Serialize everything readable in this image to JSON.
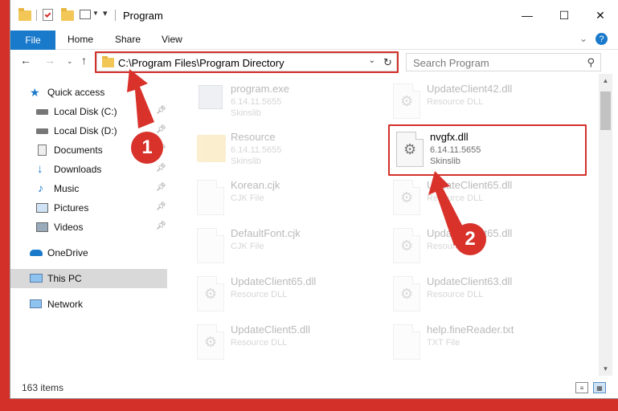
{
  "window": {
    "title": "Program"
  },
  "ribbon": {
    "file": "File",
    "home": "Home",
    "share": "Share",
    "view": "View"
  },
  "address": {
    "path": "C:\\Program Files\\Program Directory"
  },
  "search": {
    "placeholder": "Search Program"
  },
  "sidebar": {
    "items": [
      {
        "label": "Quick access",
        "icon": "star-icon"
      },
      {
        "label": "Local Disk (C:)",
        "icon": "drive-icon"
      },
      {
        "label": "Local Disk (D:)",
        "icon": "drive-icon"
      },
      {
        "label": "Documents",
        "icon": "documents-icon"
      },
      {
        "label": "Downloads",
        "icon": "download-arrow-icon"
      },
      {
        "label": "Music",
        "icon": "music-note-icon"
      },
      {
        "label": "Pictures",
        "icon": "pictures-icon"
      },
      {
        "label": "Videos",
        "icon": "video-icon"
      },
      {
        "label": "OneDrive",
        "icon": "cloud-icon"
      },
      {
        "label": "This PC",
        "icon": "computer-icon"
      },
      {
        "label": "Network",
        "icon": "network-icon"
      }
    ]
  },
  "files": [
    {
      "name": "program.exe",
      "line1": "6.14.11.5655",
      "line2": "Skinslib"
    },
    {
      "name": "UpdateClient42.dll",
      "line1": "Resource DLL",
      "line2": ""
    },
    {
      "name": "Resource",
      "line1": "6.14.11.5655",
      "line2": "Skinslib"
    },
    {
      "name": "nvgfx.dll",
      "line1": "6.14.11.5655",
      "line2": "Skinslib"
    },
    {
      "name": "Korean.cjk",
      "line1": "CJK File",
      "line2": ""
    },
    {
      "name": "UpdateClient65.dll",
      "line1": "Resource DLL",
      "line2": ""
    },
    {
      "name": "DefaultFont.cjk",
      "line1": "CJK File",
      "line2": ""
    },
    {
      "name": "UpdateClient65.dll",
      "line1": "Resource DLL",
      "line2": ""
    },
    {
      "name": "UpdateClient65.dll",
      "line1": "Resource DLL",
      "line2": ""
    },
    {
      "name": "UpdateClient63.dll",
      "line1": "Resource DLL",
      "line2": ""
    },
    {
      "name": "UpdateClient5.dll",
      "line1": "Resource DLL",
      "line2": ""
    },
    {
      "name": "help.fineReader.txt",
      "line1": "TXT File",
      "line2": ""
    }
  ],
  "status": {
    "count": "163 items"
  },
  "annotations": {
    "step1": "1",
    "step2": "2"
  },
  "colors": {
    "accent": "#1979ca",
    "highlight_red": "#d4302a",
    "folder": "#f2c657"
  }
}
